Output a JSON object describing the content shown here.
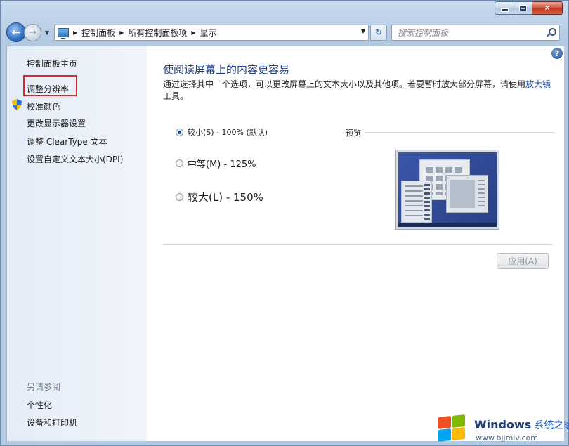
{
  "window": {
    "caption": {
      "minimize": "",
      "maximize": "",
      "close": "✕"
    }
  },
  "address": {
    "breadcrumbs": [
      "控制面板",
      "所有控制面板项",
      "显示"
    ],
    "icon": "control-panel-icon"
  },
  "search": {
    "placeholder": "搜索控制面板"
  },
  "sidebar": {
    "home": "控制面板主页",
    "items": [
      "调整分辨率",
      "校准颜色",
      "更改显示器设置",
      "调整 ClearType 文本",
      "设置自定义文本大小(DPI)"
    ],
    "see_also": "另请参阅",
    "see_also_items": [
      "个性化",
      "设备和打印机"
    ]
  },
  "main": {
    "title": "使阅读屏幕上的内容更容易",
    "description": "通过选择其中一个选项，可以更改屏幕上的文本大小以及其他项。若要暂时放大部分屏幕，请使用",
    "magnifier_link": "放大镜",
    "description_tail": "工具。",
    "options": [
      {
        "label": "较小(S) - 100% (默认)",
        "checked": true
      },
      {
        "label": "中等(M) - 125%",
        "checked": false
      },
      {
        "label": "较大(L) - 150%",
        "checked": false
      }
    ],
    "preview_label": "预览",
    "apply_button": "应用(A)",
    "help": "?"
  },
  "watermark": {
    "title": "Windows",
    "subtitle": "系统之家",
    "url": "www.bjjmlv.com"
  },
  "colors": {
    "title": "#1d3d84",
    "link": "#1a4ea3",
    "highlight": "#e0262b"
  }
}
